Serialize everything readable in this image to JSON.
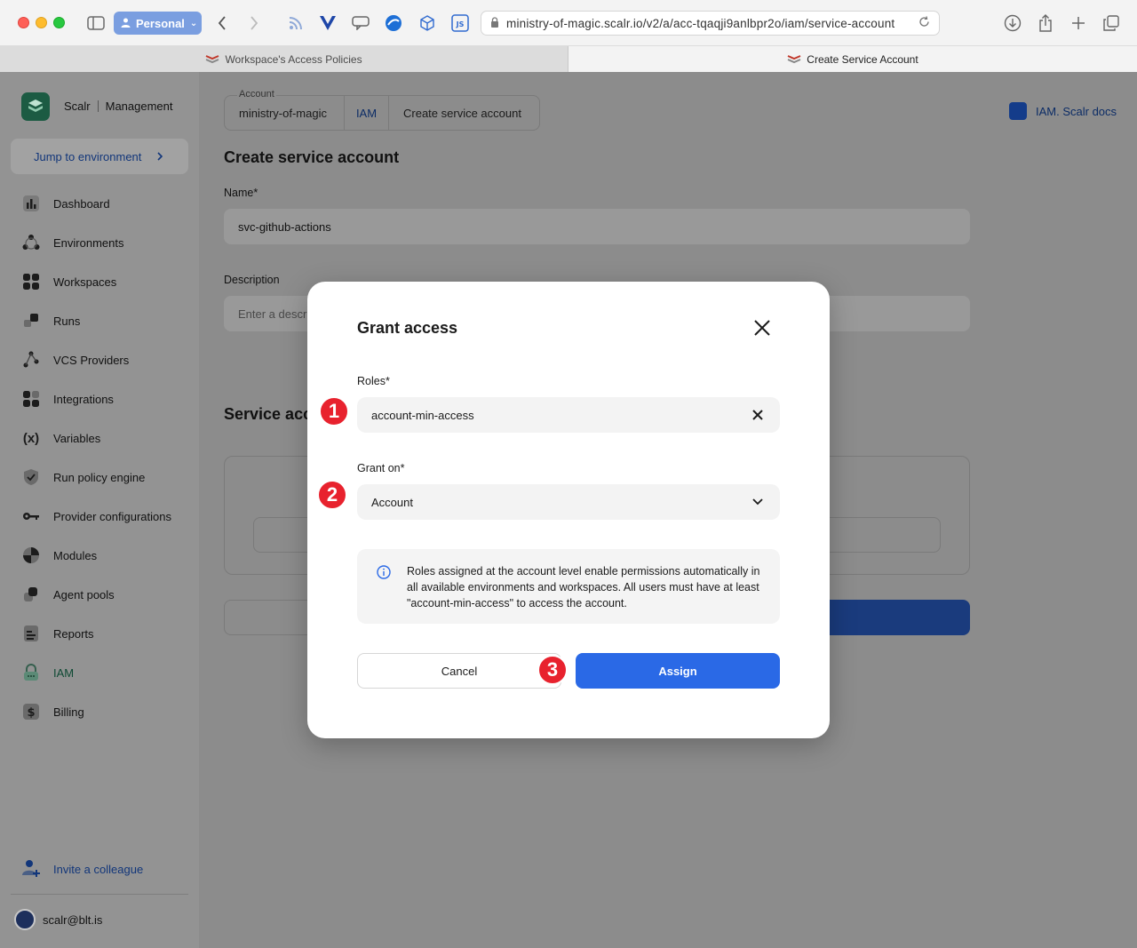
{
  "browser": {
    "profile_label": "Personal",
    "url": "ministry-of-magic.scalr.io/v2/a/acc-tqaqji9anlbpr2o/iam/service-account",
    "tabs": [
      {
        "title": "Workspace's Access Policies",
        "active": false
      },
      {
        "title": "Create Service Account",
        "active": true
      }
    ]
  },
  "sidebar": {
    "brand": "Scalr",
    "brand_section": "Management",
    "jump_label": "Jump to environment",
    "items": [
      {
        "label": "Dashboard",
        "icon": "dashboard-icon"
      },
      {
        "label": "Environments",
        "icon": "environments-icon"
      },
      {
        "label": "Workspaces",
        "icon": "workspaces-icon"
      },
      {
        "label": "Runs",
        "icon": "runs-icon"
      },
      {
        "label": "VCS Providers",
        "icon": "vcs-icon"
      },
      {
        "label": "Integrations",
        "icon": "integrations-icon"
      },
      {
        "label": "Variables",
        "icon": "variables-icon"
      },
      {
        "label": "Run policy engine",
        "icon": "shield-icon"
      },
      {
        "label": "Provider configurations",
        "icon": "key-icon"
      },
      {
        "label": "Modules",
        "icon": "modules-icon"
      },
      {
        "label": "Agent pools",
        "icon": "agent-pools-icon"
      },
      {
        "label": "Reports",
        "icon": "reports-icon"
      },
      {
        "label": "IAM",
        "icon": "lock-icon",
        "active": true
      },
      {
        "label": "Billing",
        "icon": "dollar-icon"
      }
    ],
    "invite_label": "Invite a colleague",
    "user_email": "scalr@blt.is"
  },
  "main": {
    "breadcrumb": {
      "account_caption": "Account",
      "account": "ministry-of-magic",
      "iam": "IAM",
      "current": "Create service account"
    },
    "docs_link": "IAM. Scalr docs",
    "title": "Create service account",
    "name_label": "Name*",
    "name_value": "svc-github-actions",
    "description_label": "Description",
    "description_placeholder": "Enter a descri",
    "section_title": "Service acc"
  },
  "modal": {
    "title": "Grant access",
    "roles_label": "Roles*",
    "roles_value": "account-min-access",
    "grant_on_label": "Grant on*",
    "grant_on_value": "Account",
    "info_text": "Roles assigned at the account level enable permissions automatically in all available environments and workspaces. All users must have at least \"account-min-access\" to access the account.",
    "cancel_label": "Cancel",
    "assign_label": "Assign"
  },
  "annotations": {
    "badge_1": "1",
    "badge_2": "2",
    "badge_3": "3",
    "badge_color": "#e8222e"
  },
  "colors": {
    "primary": "#2a69e6",
    "brand_green": "#1c5b43"
  }
}
